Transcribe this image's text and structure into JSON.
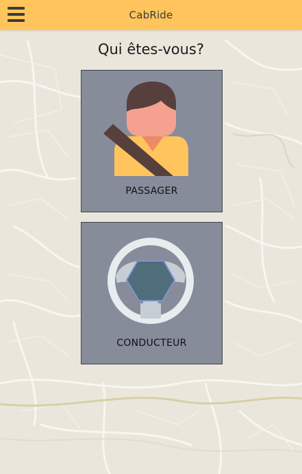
{
  "app": {
    "title": "CabRide",
    "menu_icon": "hamburger-menu-icon"
  },
  "main": {
    "question": "Qui êtes-vous?"
  },
  "options": [
    {
      "label": "PASSAGER",
      "icon": "passenger-icon"
    },
    {
      "label": "CONDUCTEUR",
      "icon": "steering-wheel-icon"
    }
  ],
  "colors": {
    "appbar": "#ffc55c",
    "card": "#878c9b",
    "map": "#ebe6dc"
  }
}
